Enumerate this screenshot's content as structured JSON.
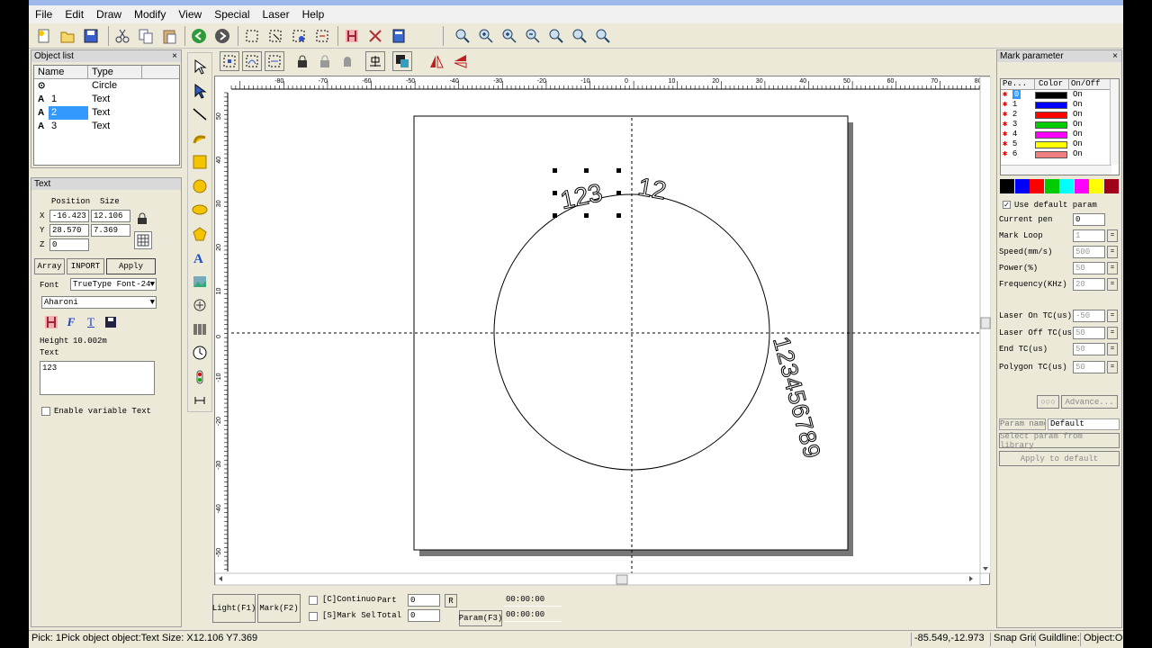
{
  "menu": [
    "File",
    "Edit",
    "Draw",
    "Modify",
    "View",
    "Special",
    "Laser",
    "Help"
  ],
  "object_list": {
    "title": "Object list",
    "col_name": "Name",
    "col_type": "Type",
    "rows": [
      {
        "icon": "⊙",
        "name": "",
        "type": "Circle"
      },
      {
        "icon": "A",
        "name": "1",
        "type": "Text"
      },
      {
        "icon": "A",
        "name": "2",
        "type": "Text"
      },
      {
        "icon": "A",
        "name": "3",
        "type": "Text"
      }
    ]
  },
  "text_panel": {
    "title": "Text",
    "pos_label": "Position",
    "size_label": "Size",
    "x_label": "X",
    "y_label": "Y",
    "z_label": "Z",
    "x": "-16.423",
    "y": "28.570",
    "z": "0",
    "size_x": "12.106",
    "size_y": "7.369",
    "array_btn": "Array",
    "import_btn": "INPORT",
    "apply_btn": "Apply",
    "font_label": "Font",
    "font_type": "TrueType Font-24",
    "font_name": "Aharoni",
    "height_label": "Height",
    "height_value": "10.002m",
    "text_label": "Text",
    "text_value": "123",
    "variable_text": "Enable variable Text"
  },
  "ruler_top": [
    "-80",
    "-70",
    "-60",
    "-50",
    "-40",
    "-30",
    "-20",
    "-10",
    "0",
    "10",
    "20",
    "30",
    "40",
    "50",
    "60",
    "70",
    "80"
  ],
  "ruler_left": [
    "50",
    "40",
    "30",
    "20",
    "10",
    "0",
    "-10",
    "-20",
    "-30",
    "-40",
    "-50"
  ],
  "canvas_text": {
    "t1": "123",
    "t2": "12",
    "t3": "123456789"
  },
  "bottom": {
    "light_btn": "Light(F1)",
    "mark_btn": "Mark(F2)",
    "continue_label": "[C]Continuo",
    "mark_sel_label": "[S]Mark Sel",
    "part_label": "Part",
    "total_label": "Total",
    "part_value": "0",
    "total_value": "0",
    "r_btn": "R",
    "param_btn": "Param(F3)",
    "time1": "00:00:00",
    "time2": "00:00:00"
  },
  "mark_param": {
    "title": "Mark parameter",
    "col_pen": "Pe...",
    "col_color": "Color",
    "col_onoff": "On/Off",
    "pens": [
      {
        "no": "0",
        "color": "#000000",
        "state": "On"
      },
      {
        "no": "1",
        "color": "#0000ff",
        "state": "On"
      },
      {
        "no": "2",
        "color": "#ff0000",
        "state": "On"
      },
      {
        "no": "3",
        "color": "#00cc00",
        "state": "On"
      },
      {
        "no": "4",
        "color": "#ff00ff",
        "state": "On"
      },
      {
        "no": "5",
        "color": "#ffff00",
        "state": "On"
      },
      {
        "no": "6",
        "color": "#f08080",
        "state": "On"
      }
    ],
    "palette": [
      "#000000",
      "#0000ff",
      "#ff0000",
      "#00cc00",
      "#00ffff",
      "#ff00ff",
      "#ffff00",
      "#a0001a"
    ],
    "use_default": "Use default param",
    "params": [
      {
        "label": "Current pen",
        "value": "0"
      },
      {
        "label": "Mark Loop",
        "value": "1"
      },
      {
        "label": "Speed(mm/s)",
        "value": "500"
      },
      {
        "label": "Power(%)",
        "value": "50"
      },
      {
        "label": "Frequency(KHz)",
        "value": "20"
      }
    ],
    "tc_params": [
      {
        "label": "Laser On TC(us)",
        "value": "-50"
      },
      {
        "label": "Laser Off TC(us",
        "value": "50"
      },
      {
        "label": "End TC(us)",
        "value": "50"
      },
      {
        "label": "Polygon TC(us)",
        "value": "50"
      }
    ],
    "advance_btn": "Advance...",
    "param_name_label": "Param name",
    "param_name_value": "Default",
    "select_lib_btn": "Select param from library",
    "apply_default_btn": "Apply to default"
  },
  "status": {
    "left": "Pick: 1Pick object object:Text Size: X12.106 Y7.369",
    "coords": "-85.549,-12.973",
    "snap": "Snap Grid",
    "guideline": "Guildline:",
    "object": "Object:O"
  }
}
